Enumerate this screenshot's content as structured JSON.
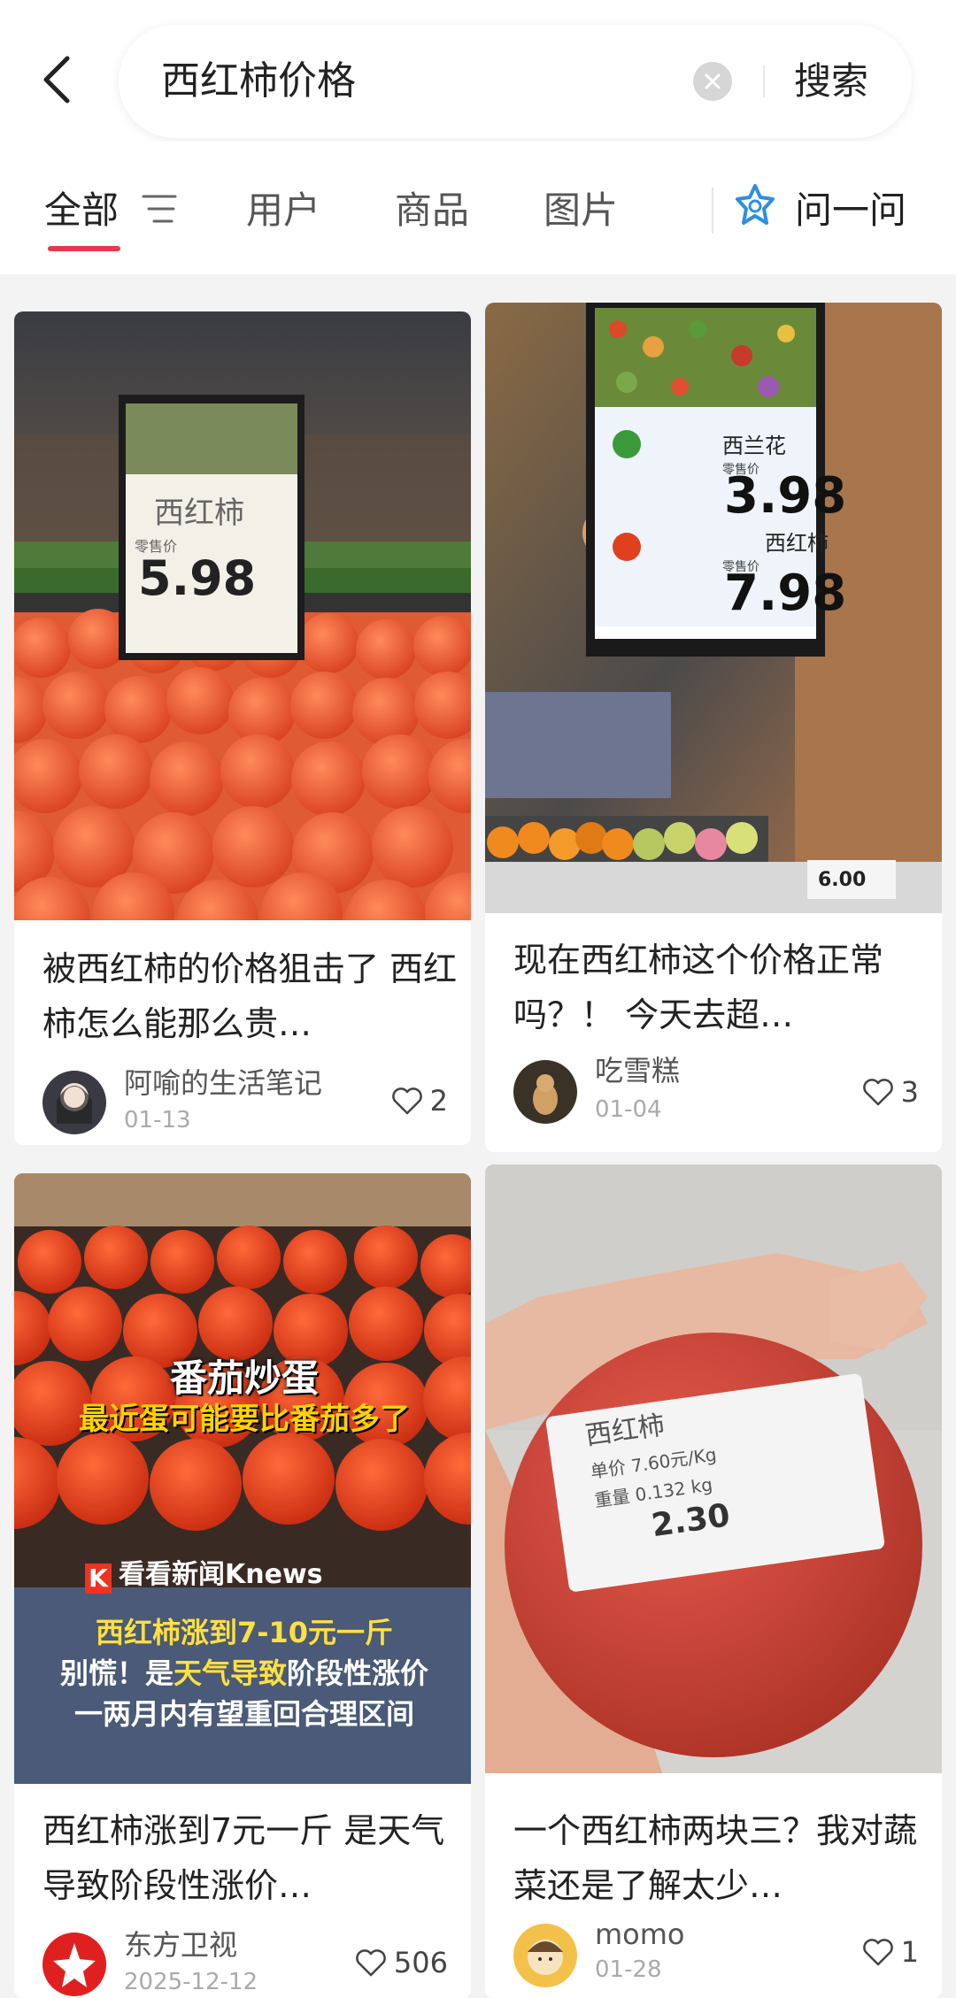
{
  "search": {
    "query": "西红柿价格",
    "button_label": "搜索"
  },
  "tabs": [
    {
      "label": "全部",
      "active": true
    },
    {
      "label": "用户",
      "active": false
    },
    {
      "label": "商品",
      "active": false
    },
    {
      "label": "图片",
      "active": false
    }
  ],
  "ask": {
    "label": "问一问"
  },
  "accent_color": "#e8384f",
  "cards": [
    {
      "title": "被西红柿的价格狙击了 西红柿怎么能那么贵…",
      "author": "阿喻的生活笔记",
      "date": "01-13",
      "likes": "2",
      "sign_name": "西红柿",
      "sign_label": "零售价",
      "sign_price": "5.98"
    },
    {
      "title": "现在西红柿这个价格正常吗？！ 今天去超…",
      "author": "吃雪糕",
      "date": "01-04",
      "likes": "3",
      "sign_item1": "西兰花",
      "sign_price1": "3.98",
      "sign_item2": "西红柿",
      "sign_price2": "7.98",
      "sign_label": "零售价",
      "shelf_price": "6.00"
    },
    {
      "title": "西红柿涨到7元一斤 是天气导致阶段性涨价…",
      "author": "东方卫视",
      "date": "2025-12-12",
      "likes": "506",
      "overlay_title": "番茄炒蛋",
      "overlay_subtitle": "最近蛋可能要比番茄多了",
      "news_brand": "看看新闻Knews",
      "overlay_line1": "西红柿涨到7-10元一斤",
      "overlay_line2_a": "别慌！是",
      "overlay_line2_b": "天气导致",
      "overlay_line2_c": "阶段性涨价",
      "overlay_line3": "一两月内有望重回合理区间"
    },
    {
      "title": "一个西红柿两块三？我对蔬菜还是了解太少…",
      "author": "momo",
      "date": "01-28",
      "likes": "1",
      "label_name": "西红柿",
      "label_unit": "单价 7.60元/Kg",
      "label_weight": "重量 0.132 kg",
      "label_total": "2.30"
    }
  ]
}
